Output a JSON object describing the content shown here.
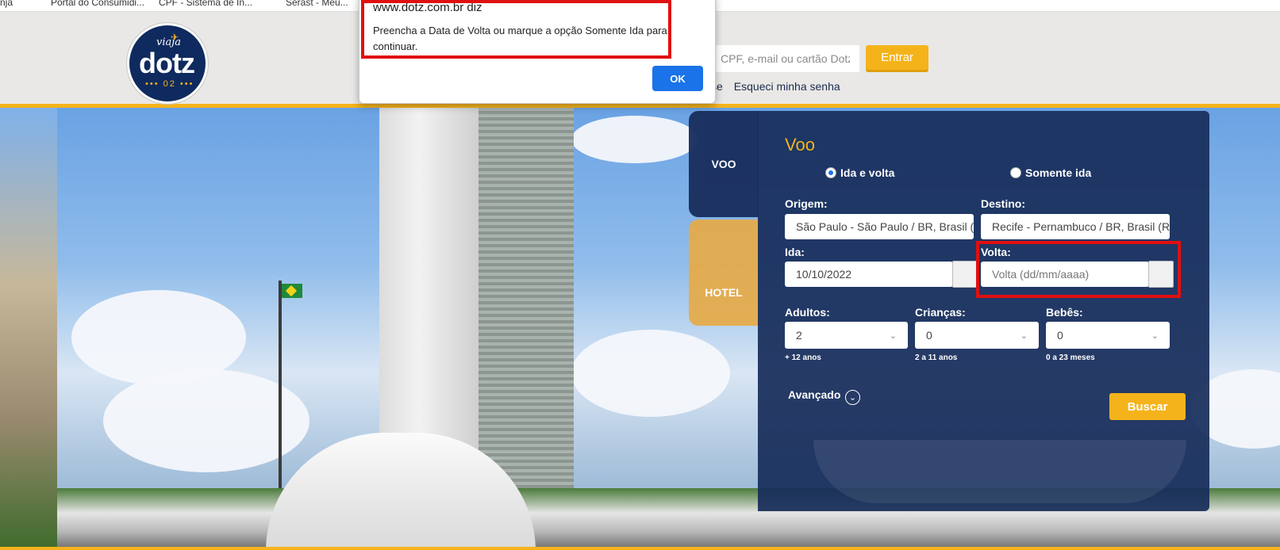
{
  "bookmarks": [
    "nja",
    "Portal do Consumidi...",
    "CPF - Sistema de In...",
    "Serast - Meu..."
  ],
  "header": {
    "logo_top": "viaja",
    "logo_word": "dotz",
    "logo_dots": "••• 02 •••",
    "login_placeholder": "CPF, e-mail ou cartão Dotz",
    "enter_label": "Entrar",
    "link_partial": "se",
    "forgot_label": "Esqueci minha senha"
  },
  "dialog": {
    "host": "www.dotz.com.br diz",
    "message": "Preencha a Data de Volta ou marque a opção Somente Ida para continuar.",
    "ok_label": "OK"
  },
  "tabs": {
    "voo": "VOO",
    "hotel": "HOTEL"
  },
  "form": {
    "title": "Voo",
    "trip_type": {
      "round_trip": "Ida e volta",
      "one_way": "Somente ida",
      "selected": "Ida e volta"
    },
    "origin_label": "Origem:",
    "origin_value": "São Paulo - São Paulo / BR, Brasil (S",
    "destination_label": "Destino:",
    "destination_value": "Recife - Pernambuco / BR, Brasil (RE",
    "depart_label": "Ida:",
    "depart_value": "10/10/2022",
    "return_label": "Volta:",
    "return_placeholder": "Volta (dd/mm/aaaa)",
    "adults_label": "Adultos:",
    "adults_value": "2",
    "adults_hint": "+ 12 anos",
    "children_label": "Crianças:",
    "children_value": "0",
    "children_hint": "2 a 11 anos",
    "babies_label": "Bebês:",
    "babies_value": "0",
    "babies_hint": "0 a 23 meses",
    "advanced_label": "Avançado",
    "search_label": "Buscar"
  },
  "colors": {
    "accent": "#f5b31b",
    "panel": "#1a2f5e",
    "highlight": "#e01010",
    "ok_button": "#1a73e8"
  }
}
